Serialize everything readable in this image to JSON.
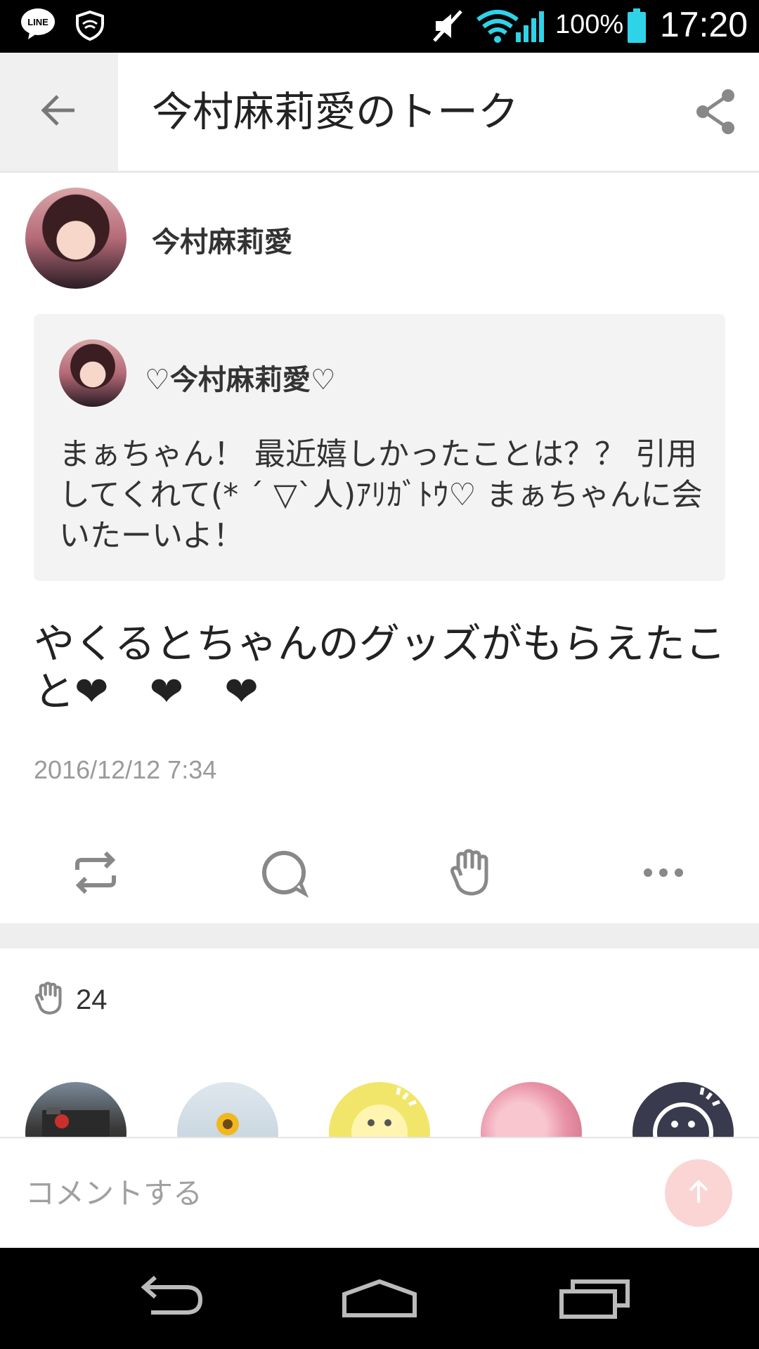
{
  "status_bar": {
    "battery_percent": "100%",
    "time": "17:20",
    "icons": [
      "line-icon",
      "shield-icon",
      "mute-icon",
      "wifi-icon",
      "signal-icon",
      "battery-icon"
    ]
  },
  "header": {
    "title": "今村麻莉愛のトーク",
    "back_icon": "back-arrow-icon",
    "share_icon": "share-icon"
  },
  "post": {
    "author_name": "今村麻莉愛",
    "quoted": {
      "author_name": "♡今村麻莉愛♡",
      "text": "まぁちゃん！ 最近嬉しかったことは？？ 引用してくれて(* ´ ▽`人)ｱﾘｶﾞﾄｳ♡ まぁちゃんに会いたーいよ！"
    },
    "text": "やくるとちゃんのグッズがもらえたこと❤　❤　❤",
    "timestamp": "2016/12/12 7:34"
  },
  "actions": {
    "items": [
      "repost-icon",
      "comment-icon",
      "applause-icon",
      "more-icon"
    ]
  },
  "likes": {
    "count": "24",
    "icon": "applause-icon"
  },
  "comment_bar": {
    "placeholder": "コメントする",
    "send_icon": "send-arrow-icon"
  },
  "colors": {
    "accent_send": "#fbd4d4",
    "status_wifi": "#2fd3e8",
    "quote_bg": "#f3f3f3"
  }
}
